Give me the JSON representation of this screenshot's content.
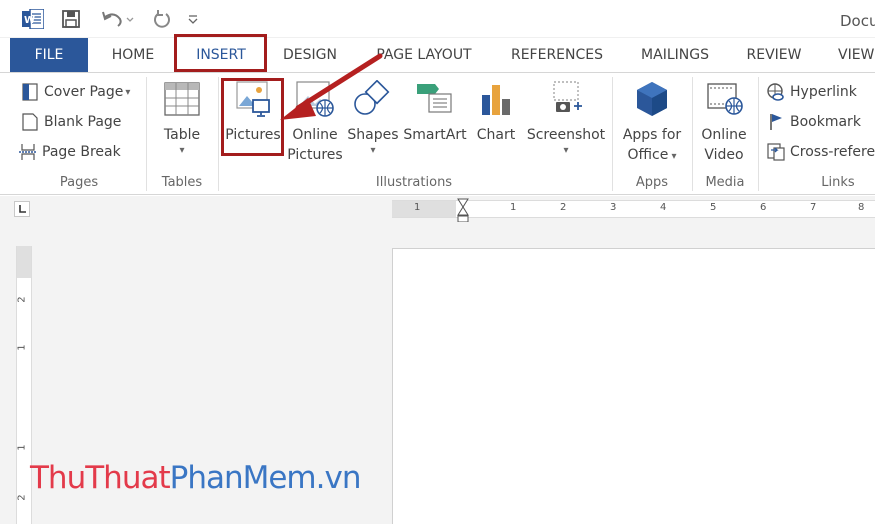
{
  "window": {
    "title": "Docu"
  },
  "tabs": [
    "FILE",
    "HOME",
    "INSERT",
    "DESIGN",
    "PAGE LAYOUT",
    "REFERENCES",
    "MAILINGS",
    "REVIEW",
    "VIEW"
  ],
  "ribbon": {
    "pages": {
      "cover_page": "Cover Page",
      "blank_page": "Blank Page",
      "page_break": "Page Break",
      "label": "Pages"
    },
    "tables": {
      "table": "Table",
      "label": "Tables"
    },
    "illustrations": {
      "pictures": "Pictures",
      "online_pictures_1": "Online",
      "online_pictures_2": "Pictures",
      "shapes": "Shapes",
      "smartart": "SmartArt",
      "chart": "Chart",
      "screenshot": "Screenshot",
      "label": "Illustrations"
    },
    "apps": {
      "apps_1": "Apps for",
      "apps_2": "Office",
      "label": "Apps"
    },
    "media": {
      "video_1": "Online",
      "video_2": "Video",
      "label": "Media"
    },
    "links": {
      "hyperlink": "Hyperlink",
      "bookmark": "Bookmark",
      "cross_ref": "Cross-refere",
      "label": "Links"
    }
  },
  "ruler": {
    "h": [
      "1",
      "1",
      "2",
      "3",
      "4",
      "5",
      "6",
      "7",
      "8"
    ],
    "v": [
      "2",
      "1",
      "1",
      "2"
    ]
  },
  "watermark": {
    "part1": "ThuThuat",
    "part2": "PhanMem",
    "part3": ".vn"
  },
  "colors": {
    "accent": "#2b579a",
    "highlight": "#a31d1d"
  }
}
